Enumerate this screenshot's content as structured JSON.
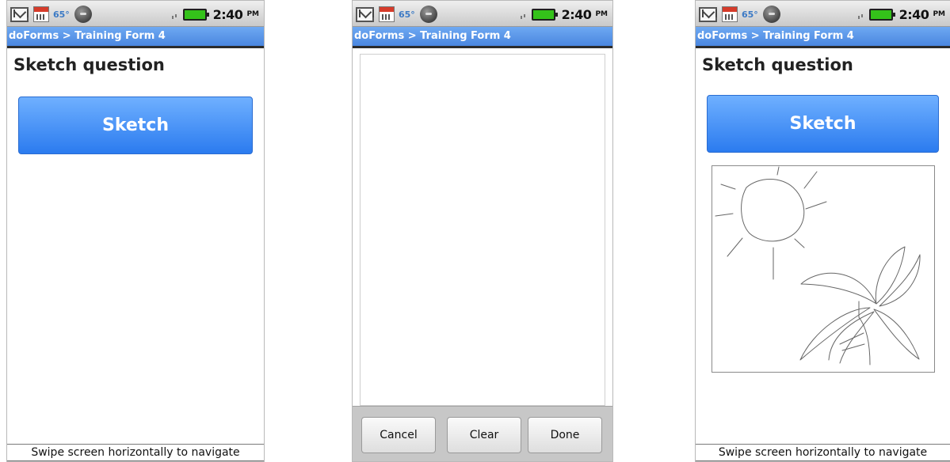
{
  "status_bar": {
    "temperature": "65°",
    "time": "2:40",
    "ampm": "PM",
    "battery_color": "#34c21a"
  },
  "title_bar": {
    "title": "doForms > Training Form 4",
    "color": "#4a86df"
  },
  "screens": [
    {
      "question_label": "Sketch question",
      "sketch_button_label": "Sketch",
      "hint": "Swipe screen horizontally to navigate"
    },
    {
      "actions": {
        "cancel": "Cancel",
        "clear": "Clear",
        "done": "Done"
      }
    },
    {
      "question_label": "Sketch question",
      "sketch_button_label": "Sketch",
      "hint": "Swipe screen horizontally to navigate",
      "drawing_description": "sun-and-palm-tree-sketch"
    }
  ],
  "icons": [
    "gmail-icon",
    "calendar-icon",
    "weather-icon",
    "signal-icon",
    "battery-icon"
  ]
}
